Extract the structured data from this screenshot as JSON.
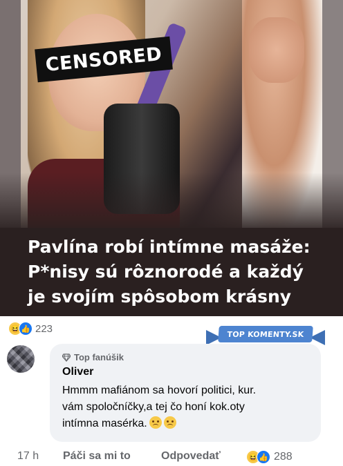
{
  "hero": {
    "censor_label": "CENSORED",
    "headline_lines": [
      "Pavlína robí intímne masáže:",
      "P*nisy sú rôznorodé a každý",
      "je svojím spôsobom krásny"
    ]
  },
  "post_reactions": {
    "icons": [
      "haha-emoji-icon",
      "like-emoji-icon"
    ],
    "count": "223"
  },
  "ribbon": {
    "label": "TOP KOMENTY.SK"
  },
  "comment": {
    "badge": "Top fanúšik",
    "author": "Oliver",
    "text_lines": [
      "Hmmm mafiánom sa hovorí politici, kur.",
      "vám spoločníčky,a tej čo honí kok.oty",
      "intímna masérka."
    ],
    "emoji_trailing": [
      "sad-face-icon",
      "sad-face-icon"
    ]
  },
  "footer": {
    "time": "17 h",
    "like_label": "Páči sa mi to",
    "reply_label": "Odpovedať",
    "reaction_count": "288"
  },
  "colors": {
    "accent_blue": "#1877f2",
    "ribbon_blue": "#4d84d0",
    "bubble_bg": "#f0f2f5",
    "secondary_text": "#65676b"
  }
}
